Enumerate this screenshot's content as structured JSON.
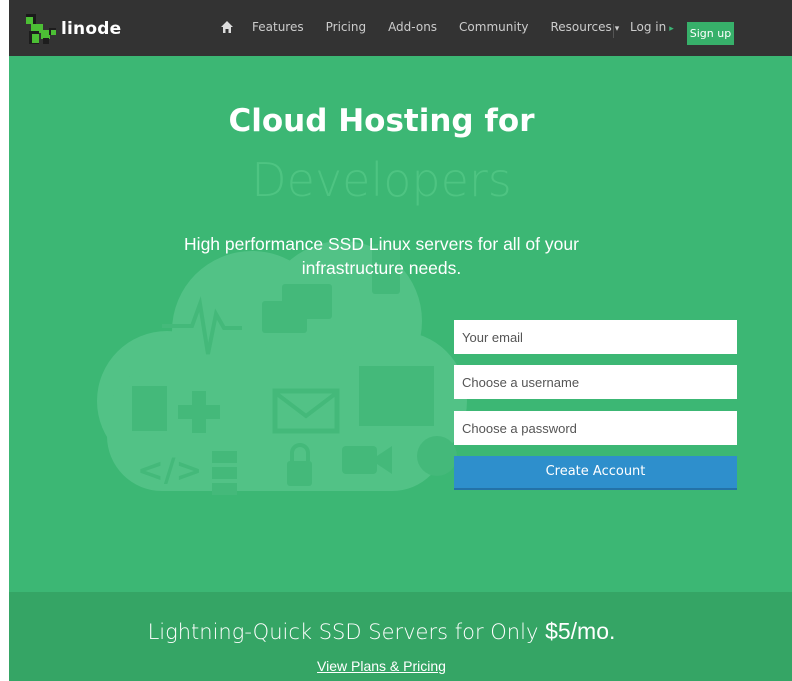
{
  "brand": {
    "name": "linode"
  },
  "nav": {
    "items": [
      {
        "label": "Features"
      },
      {
        "label": "Pricing"
      },
      {
        "label": "Add-ons"
      },
      {
        "label": "Community"
      },
      {
        "label": "Resources"
      }
    ],
    "login_label": "Log in",
    "signup_label": "Sign up"
  },
  "hero": {
    "title": "Cloud Hosting for",
    "rotator_word": "Developers",
    "subtitle": "High performance SSD Linux servers for all of your infrastructure needs.",
    "form": {
      "email_placeholder": "Your email",
      "username_placeholder": "Choose a username",
      "password_placeholder": "Choose a password",
      "submit_label": "Create Account"
    }
  },
  "footer": {
    "headline": "Lightning-Quick SSD Servers for Only",
    "price": "$5/mo.",
    "link_label": "View Plans & Pricing"
  },
  "colors": {
    "nav_bg": "#333333",
    "hero_bg": "#3cb774",
    "footer_bg": "#35a565",
    "signup_bg": "#37b06a",
    "cta_bg": "#2e8fcc",
    "logo_green": "#4cbf35"
  },
  "icons": [
    "home-icon",
    "caret-down-icon",
    "arrow-right-icon",
    "cloud-illustration"
  ]
}
